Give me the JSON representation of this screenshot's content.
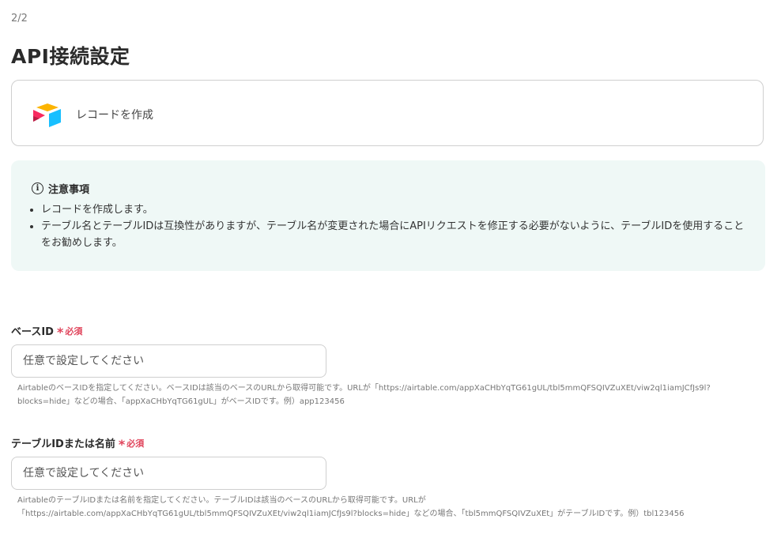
{
  "step": "2/2",
  "title": "API接続設定",
  "action": {
    "label": "レコードを作成",
    "app_icon": "airtable-logo"
  },
  "notice": {
    "heading": "注意事項",
    "items": [
      "レコードを作成します。",
      "テーブル名とテーブルIDは互換性がありますが、テーブル名が変更された場合にAPIリクエストを修正する必要がないように、テーブルIDを使用することをお勧めします。"
    ]
  },
  "fields": [
    {
      "label": "ベースID",
      "required_mark": "*",
      "required_text": "必須",
      "placeholder": "任意で設定してください",
      "value": "",
      "help": "AirtableのベースIDを指定してください。ベースIDは該当のベースのURLから取得可能です。URLが「https://airtable.com/appXaCHbYqTG61gUL/tbl5mmQFSQIVZuXEt/viw2ql1iamJCfJs9l?blocks=hide」などの場合、「appXaCHbYqTG61gUL」がベースIDです。例）app123456"
    },
    {
      "label": "テーブルIDまたは名前",
      "required_mark": "*",
      "required_text": "必須",
      "placeholder": "任意で設定してください",
      "value": "",
      "help": "AirtableのテーブルIDまたは名前を指定してください。テーブルIDは該当のベースのURLから取得可能です。URLが「https://airtable.com/appXaCHbYqTG61gUL/tbl5mmQFSQIVZuXEt/viw2ql1iamJCfJs9l?blocks=hide」などの場合、「tbl5mmQFSQIVZuXEt」がテーブルIDです。例）tbl123456"
    }
  ],
  "colors": {
    "required": "#e0445b",
    "notice_bg": "#eff8f6",
    "border": "#cfcfcf"
  }
}
